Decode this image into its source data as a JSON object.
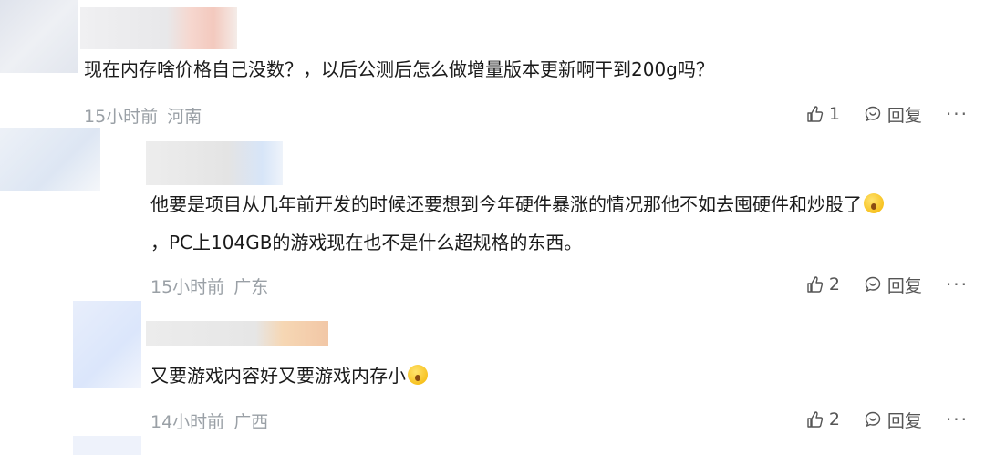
{
  "comments": [
    {
      "text": "现在内存啥价格自己没数？，以后公测后怎么做增量版本更新啊干到200g吗？",
      "time": "15小时前",
      "location": "河南",
      "likes": "1",
      "reply_label": "回复",
      "more_label": "···"
    },
    {
      "text_line1": "他要是项目从几年前开发的时候还要想到今年硬件暴涨的情况那他不如去囤硬件和炒股了",
      "text_line2": "，PC上104GB的游戏现在也不是什么超规格的东西。",
      "time": "15小时前",
      "location": "广东",
      "likes": "2",
      "reply_label": "回复",
      "more_label": "···"
    },
    {
      "text": "又要游戏内容好又要游戏内存小",
      "time": "14小时前",
      "location": "广西",
      "likes": "2",
      "reply_label": "回复",
      "more_label": "···"
    }
  ]
}
